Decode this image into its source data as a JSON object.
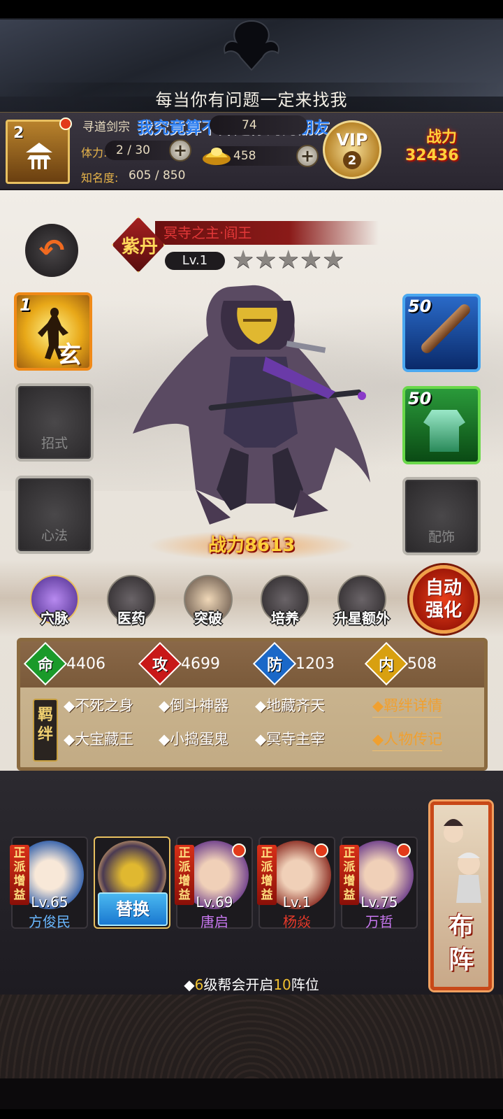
{
  "marquee": "每当你有问题一定来找我",
  "player": {
    "level": "2",
    "sect": "寻道剑宗",
    "overlay_text": "我究竟算不算是你的男朋友",
    "stamina_label": "体力:",
    "stamina_value": "2 / 30",
    "fame_label": "知名度:",
    "fame_value": "605 / 850",
    "currency_top": "74",
    "gold": "458",
    "vip_label": "VIP",
    "vip_level": "2",
    "power_label": "战力",
    "power_value": "32436"
  },
  "hero": {
    "badge": "紫丹",
    "name": "冥寺之主·阎王",
    "level": "Lv.1",
    "stars": 5,
    "battle_power": "战力8613"
  },
  "slots": {
    "technique_count": "1",
    "technique_glyph": "玄",
    "move_label": "招式",
    "mind_label": "心法",
    "weapon_count": "50",
    "armor_count": "50",
    "accessory_label": "配饰"
  },
  "functions": [
    "穴脉",
    "医药",
    "突破",
    "培养",
    "升星额外"
  ],
  "auto_button": "自动强化",
  "stats": [
    {
      "label": "命",
      "value": "4406",
      "color": "#1a9a2a"
    },
    {
      "label": "攻",
      "value": "4699",
      "color": "#c81818"
    },
    {
      "label": "防",
      "value": "1203",
      "color": "#1a68c8"
    },
    {
      "label": "内",
      "value": "508",
      "color": "#d8a010"
    }
  ],
  "bond_tag": "羁绊",
  "bonds": [
    "◆不死之身",
    "◆倒斗神器",
    "◆地藏齐天",
    "◆大宝藏王",
    "◆小捣蛋鬼",
    "◆冥寺主宰"
  ],
  "bond_links": [
    "◆羁绊详情",
    "◆人物传记"
  ],
  "team": [
    {
      "tag": "正派增益",
      "level": "Lv.65",
      "name": "方俊民",
      "name_color": "#6ab8ff",
      "dot": false
    },
    {
      "swap": "替换"
    },
    {
      "tag": "正派增益",
      "level": "Lv.69",
      "name": "唐启",
      "name_color": "#c878f0",
      "dot": true
    },
    {
      "tag": "正派增益",
      "level": "Lv.1",
      "name": "杨焱",
      "name_color": "#e83a2a",
      "dot": true
    },
    {
      "tag": "正派增益",
      "level": "Lv.75",
      "name": "万哲",
      "name_color": "#c878f0",
      "dot": true
    }
  ],
  "formation": "布阵",
  "tip": {
    "prefix": "◆",
    "num1": "6",
    "mid": "级帮会开启",
    "num2": "10",
    "suffix": "阵位"
  }
}
